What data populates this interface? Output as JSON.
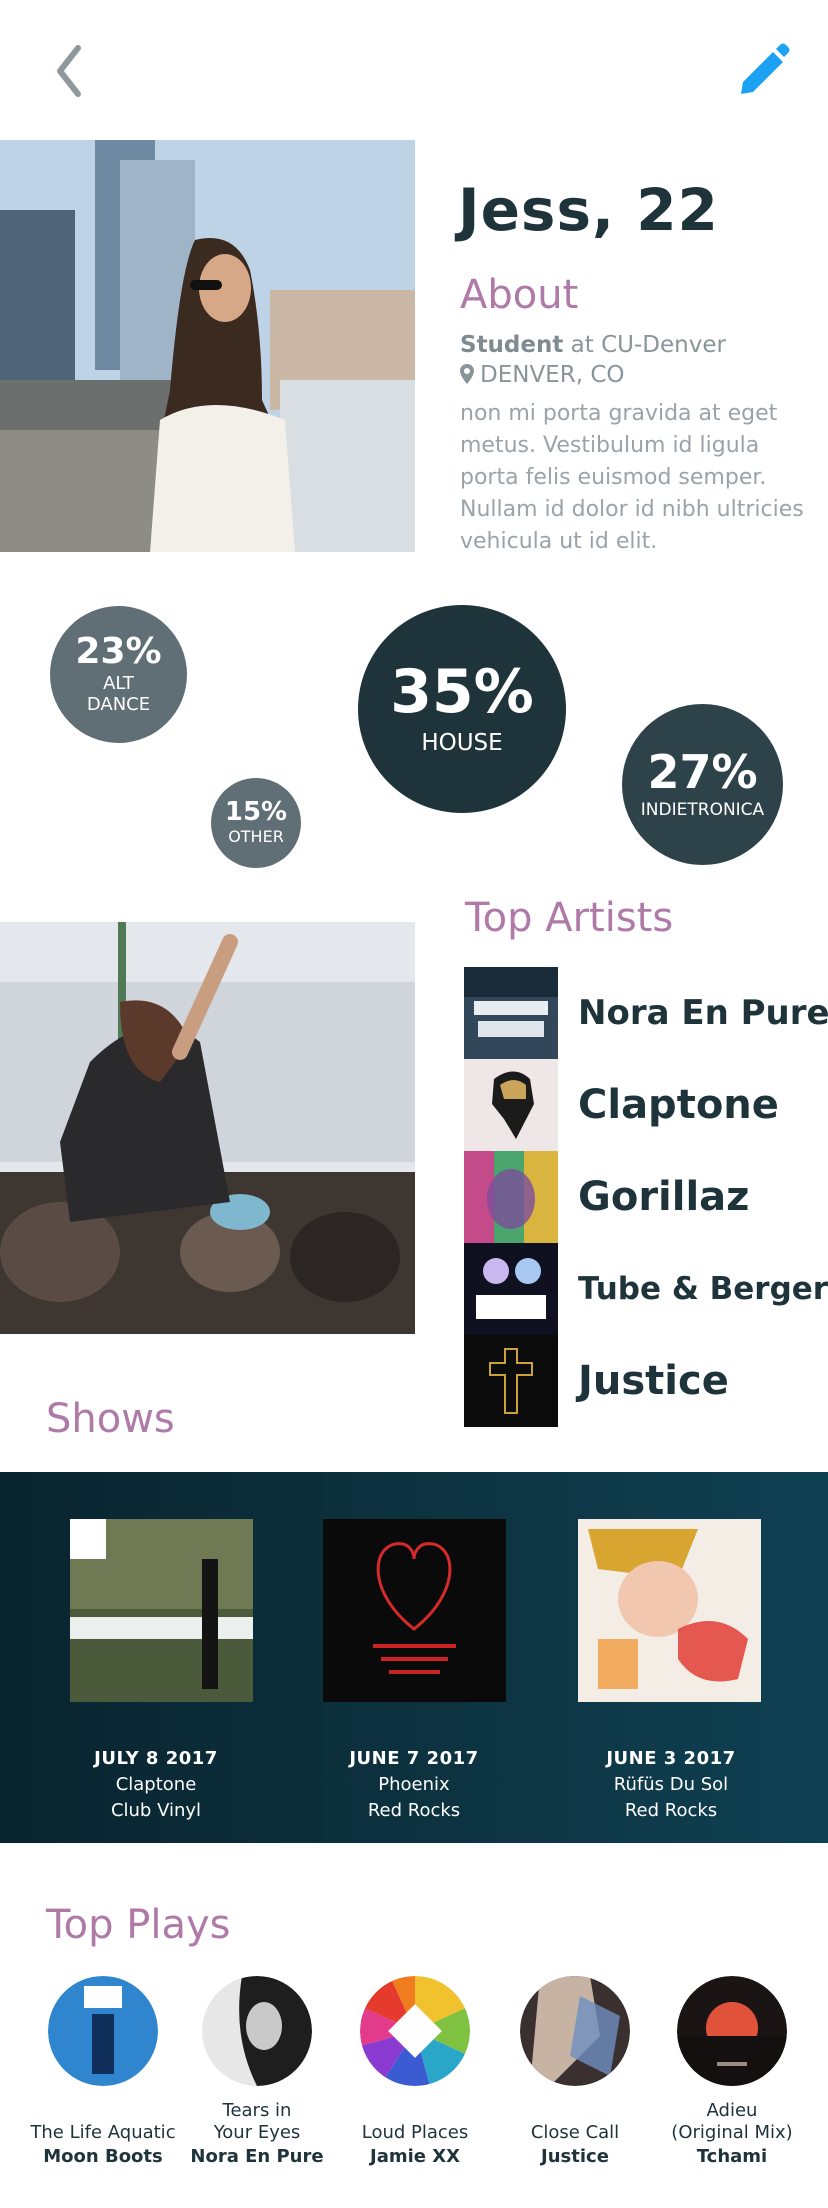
{
  "header": {
    "back_icon": "chevron-left-icon",
    "edit_icon": "pencil-icon",
    "accent": "#1da1f2"
  },
  "profile": {
    "name": "Jess, 22",
    "about_heading": "About",
    "occupation_strong": "Student",
    "occupation_rest": " at CU-Denver",
    "location": "DENVER, CO",
    "location_icon": "map-pin-icon",
    "bio": "non mi porta gravida at eget metus. Vestibulum id ligula porta felis euismod semper. Nullam id dolor id nibh ultricies vehicula ut id elit."
  },
  "genres": [
    {
      "percent": "23%",
      "label_line1": "ALT",
      "label_line2": "DANCE",
      "value": 23
    },
    {
      "percent": "35%",
      "label_line1": "HOUSE",
      "value": 35
    },
    {
      "percent": "27%",
      "label_line1": "INDIETRONICA",
      "value": 27
    },
    {
      "percent": "15%",
      "label_line1": "OTHER",
      "value": 15
    }
  ],
  "top_artists": {
    "heading": "Top Artists",
    "items": [
      {
        "name": "Nora En Pure"
      },
      {
        "name": "Claptone"
      },
      {
        "name": "Gorillaz"
      },
      {
        "name": "Tube & Berger"
      },
      {
        "name": "Justice"
      }
    ]
  },
  "shows": {
    "heading": "Shows",
    "items": [
      {
        "date": "JULY 8 2017",
        "artist": "Claptone",
        "venue": "Club Vinyl"
      },
      {
        "date": "JUNE 7 2017",
        "artist": "Phoenix",
        "venue": "Red Rocks"
      },
      {
        "date": "JUNE 3 2017",
        "artist": "Rüfüs Du Sol",
        "venue": "Red Rocks"
      }
    ]
  },
  "top_plays": {
    "heading": "Top Plays",
    "items": [
      {
        "title": "The Life Aquatic",
        "artist": "Moon Boots"
      },
      {
        "title": "Tears in Your Eyes",
        "title_line1": "Tears in",
        "title_line2": "Your Eyes",
        "artist": "Nora En Pure"
      },
      {
        "title": "Loud Places",
        "artist": "Jamie XX"
      },
      {
        "title": "Close Call",
        "artist": "Justice"
      },
      {
        "title": "Adieu (Original Mix)",
        "title_line1": "Adieu",
        "title_line2": "(Original Mix)",
        "artist": "Tchami"
      }
    ]
  },
  "colors": {
    "dark": "#1f333b",
    "accent_purple": "#b07aa8",
    "bubble_gray": "#5f6f75"
  }
}
